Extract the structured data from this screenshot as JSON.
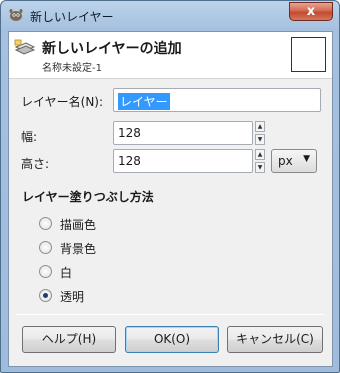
{
  "window": {
    "title": "新しいレイヤー",
    "close_glyph": "x"
  },
  "header": {
    "title": "新しいレイヤーの追加",
    "subtitle": "名称未設定-1"
  },
  "form": {
    "name_label": "レイヤー名(N):",
    "name_value": "レイヤー",
    "width_label": "幅:",
    "width_value": "128",
    "height_label": "高さ:",
    "height_value": "128",
    "unit_value": "px",
    "unit_arrow": "▼"
  },
  "fill": {
    "title": "レイヤー塗りつぶし方法",
    "options": [
      {
        "label": "描画色",
        "checked": false
      },
      {
        "label": "背景色",
        "checked": false
      },
      {
        "label": "白",
        "checked": false
      },
      {
        "label": "透明",
        "checked": true
      }
    ]
  },
  "buttons": {
    "help": "ヘルプ(H)",
    "ok": "OK(O)",
    "cancel": "キャンセル(C)"
  },
  "colors": {
    "selection": "#3399ff",
    "titlebar": "#a6c1df",
    "close": "#c24a30"
  }
}
